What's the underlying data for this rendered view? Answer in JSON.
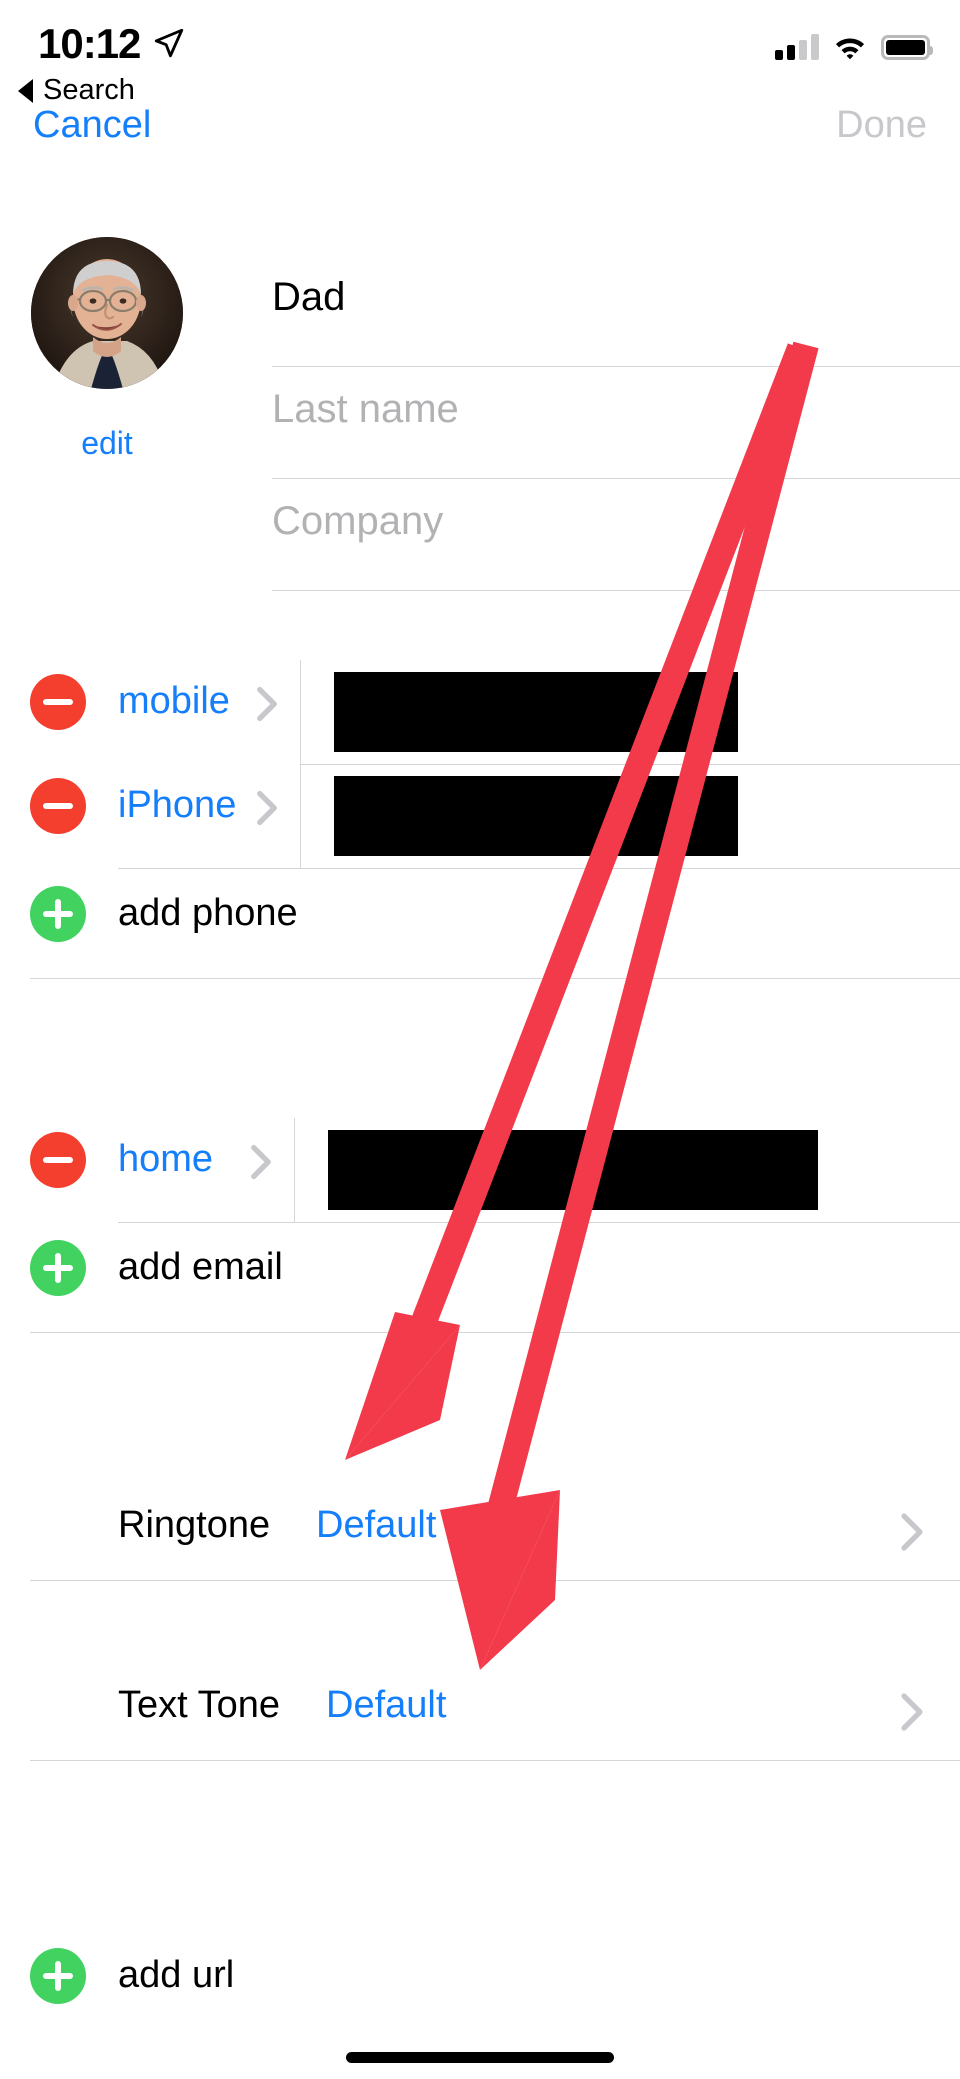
{
  "status_bar": {
    "time": "10:12",
    "location_icon": "location-arrow-icon",
    "signal_icon": "cellular-signal-icon",
    "signal_bars_filled": 2,
    "signal_bars_total": 4,
    "wifi_icon": "wifi-icon",
    "battery_icon": "battery-full-icon"
  },
  "back_nav": {
    "icon": "back-triangle-icon",
    "label": "Search"
  },
  "navbar": {
    "cancel_label": "Cancel",
    "done_label": "Done",
    "done_disabled": true
  },
  "contact": {
    "photo_alt": "contact-photo",
    "edit_label": "edit",
    "first_name_value": "Dad",
    "last_name_placeholder": "Last name",
    "company_placeholder": "Company"
  },
  "phones": {
    "rows": [
      {
        "delete_icon": "minus-circle-icon",
        "label": "mobile",
        "chevron": "chevron-right-icon",
        "value": "",
        "redacted": true
      },
      {
        "delete_icon": "minus-circle-icon",
        "label": "iPhone",
        "chevron": "chevron-right-icon",
        "value": "",
        "redacted": true
      }
    ],
    "add_label": "add phone",
    "add_icon": "plus-circle-icon"
  },
  "emails": {
    "rows": [
      {
        "delete_icon": "minus-circle-icon",
        "label": "home",
        "chevron": "chevron-right-icon",
        "value": "",
        "redacted": true
      }
    ],
    "add_label": "add email",
    "add_icon": "plus-circle-icon"
  },
  "tones": [
    {
      "label": "Ringtone",
      "value": "Default",
      "chevron": "chevron-right-icon"
    },
    {
      "label": "Text Tone",
      "value": "Default",
      "chevron": "chevron-right-icon"
    }
  ],
  "urls": {
    "add_label": "add url",
    "add_icon": "plus-circle-icon"
  },
  "annotations": {
    "arrow_color": "#f23a4a",
    "arrows": [
      {
        "name": "arrow-to-ringtone",
        "target": "Ringtone Default"
      },
      {
        "name": "arrow-to-text-tone",
        "target": "Text Tone Default"
      }
    ]
  },
  "colors": {
    "link_blue": "#147efb",
    "disabled_grey": "#c7c7cc",
    "delete_red": "#f53f2e",
    "add_green": "#41d25f",
    "separator": "#d6d6d8",
    "placeholder": "#b2b2b5"
  }
}
